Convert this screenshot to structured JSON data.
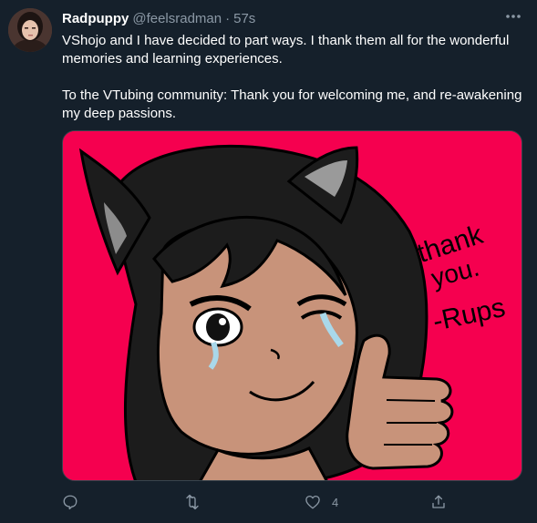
{
  "tweet": {
    "display_name": "Radpuppy",
    "handle": "@feelsradman",
    "separator": "·",
    "time": "57s",
    "paragraphs": [
      "VShojo and I have decided to part ways. I thank them all for the wonderful memories and learning experiences.",
      "To the VTubing community: Thank you for welcoming me, and re-awakening my deep passions."
    ],
    "more_icon": "more-horizontal-icon"
  },
  "media": {
    "background_color": "#f5004f",
    "handwriting_lines": [
      "thank",
      "you.",
      "-Rups"
    ]
  },
  "actions": {
    "reply_icon": "reply-icon",
    "retweet_icon": "retweet-icon",
    "like_icon": "heart-icon",
    "like_count": "4",
    "share_icon": "share-icon"
  },
  "colors": {
    "background": "#15202b",
    "secondary_text": "#8b98a5",
    "primary_text": "#ffffff"
  }
}
